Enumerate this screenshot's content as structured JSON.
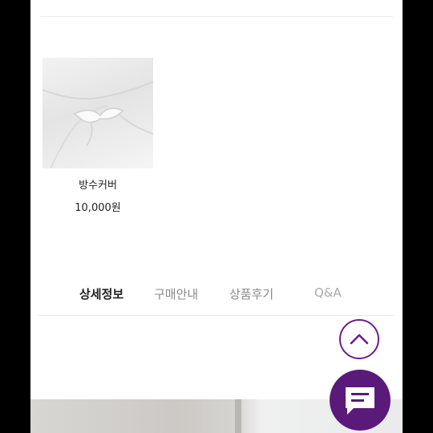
{
  "product": {
    "name": "방수커버",
    "price": "10,000원"
  },
  "tabs": [
    {
      "label": "상세정보",
      "active": true
    },
    {
      "label": "구매안내",
      "active": false
    },
    {
      "label": "상품후기",
      "active": false
    },
    {
      "label": "Q&A",
      "active": false
    }
  ],
  "colors": {
    "accent": "#5a1a7a",
    "accent_border": "#6a1f8a"
  },
  "icons": {
    "scroll_top": "chevron-up-icon",
    "chat": "chat-bubble-icon"
  }
}
